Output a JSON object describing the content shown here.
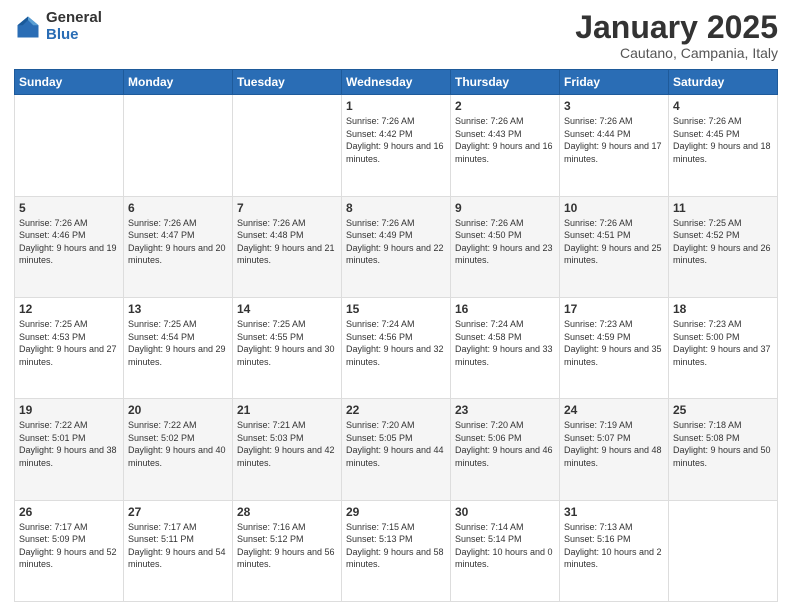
{
  "header": {
    "logo_general": "General",
    "logo_blue": "Blue",
    "title": "January 2025",
    "subtitle": "Cautano, Campania, Italy"
  },
  "weekdays": [
    "Sunday",
    "Monday",
    "Tuesday",
    "Wednesday",
    "Thursday",
    "Friday",
    "Saturday"
  ],
  "weeks": [
    [
      {
        "day": "",
        "sunrise": "",
        "sunset": "",
        "daylight": ""
      },
      {
        "day": "",
        "sunrise": "",
        "sunset": "",
        "daylight": ""
      },
      {
        "day": "",
        "sunrise": "",
        "sunset": "",
        "daylight": ""
      },
      {
        "day": "1",
        "sunrise": "Sunrise: 7:26 AM",
        "sunset": "Sunset: 4:42 PM",
        "daylight": "Daylight: 9 hours and 16 minutes."
      },
      {
        "day": "2",
        "sunrise": "Sunrise: 7:26 AM",
        "sunset": "Sunset: 4:43 PM",
        "daylight": "Daylight: 9 hours and 16 minutes."
      },
      {
        "day": "3",
        "sunrise": "Sunrise: 7:26 AM",
        "sunset": "Sunset: 4:44 PM",
        "daylight": "Daylight: 9 hours and 17 minutes."
      },
      {
        "day": "4",
        "sunrise": "Sunrise: 7:26 AM",
        "sunset": "Sunset: 4:45 PM",
        "daylight": "Daylight: 9 hours and 18 minutes."
      }
    ],
    [
      {
        "day": "5",
        "sunrise": "Sunrise: 7:26 AM",
        "sunset": "Sunset: 4:46 PM",
        "daylight": "Daylight: 9 hours and 19 minutes."
      },
      {
        "day": "6",
        "sunrise": "Sunrise: 7:26 AM",
        "sunset": "Sunset: 4:47 PM",
        "daylight": "Daylight: 9 hours and 20 minutes."
      },
      {
        "day": "7",
        "sunrise": "Sunrise: 7:26 AM",
        "sunset": "Sunset: 4:48 PM",
        "daylight": "Daylight: 9 hours and 21 minutes."
      },
      {
        "day": "8",
        "sunrise": "Sunrise: 7:26 AM",
        "sunset": "Sunset: 4:49 PM",
        "daylight": "Daylight: 9 hours and 22 minutes."
      },
      {
        "day": "9",
        "sunrise": "Sunrise: 7:26 AM",
        "sunset": "Sunset: 4:50 PM",
        "daylight": "Daylight: 9 hours and 23 minutes."
      },
      {
        "day": "10",
        "sunrise": "Sunrise: 7:26 AM",
        "sunset": "Sunset: 4:51 PM",
        "daylight": "Daylight: 9 hours and 25 minutes."
      },
      {
        "day": "11",
        "sunrise": "Sunrise: 7:25 AM",
        "sunset": "Sunset: 4:52 PM",
        "daylight": "Daylight: 9 hours and 26 minutes."
      }
    ],
    [
      {
        "day": "12",
        "sunrise": "Sunrise: 7:25 AM",
        "sunset": "Sunset: 4:53 PM",
        "daylight": "Daylight: 9 hours and 27 minutes."
      },
      {
        "day": "13",
        "sunrise": "Sunrise: 7:25 AM",
        "sunset": "Sunset: 4:54 PM",
        "daylight": "Daylight: 9 hours and 29 minutes."
      },
      {
        "day": "14",
        "sunrise": "Sunrise: 7:25 AM",
        "sunset": "Sunset: 4:55 PM",
        "daylight": "Daylight: 9 hours and 30 minutes."
      },
      {
        "day": "15",
        "sunrise": "Sunrise: 7:24 AM",
        "sunset": "Sunset: 4:56 PM",
        "daylight": "Daylight: 9 hours and 32 minutes."
      },
      {
        "day": "16",
        "sunrise": "Sunrise: 7:24 AM",
        "sunset": "Sunset: 4:58 PM",
        "daylight": "Daylight: 9 hours and 33 minutes."
      },
      {
        "day": "17",
        "sunrise": "Sunrise: 7:23 AM",
        "sunset": "Sunset: 4:59 PM",
        "daylight": "Daylight: 9 hours and 35 minutes."
      },
      {
        "day": "18",
        "sunrise": "Sunrise: 7:23 AM",
        "sunset": "Sunset: 5:00 PM",
        "daylight": "Daylight: 9 hours and 37 minutes."
      }
    ],
    [
      {
        "day": "19",
        "sunrise": "Sunrise: 7:22 AM",
        "sunset": "Sunset: 5:01 PM",
        "daylight": "Daylight: 9 hours and 38 minutes."
      },
      {
        "day": "20",
        "sunrise": "Sunrise: 7:22 AM",
        "sunset": "Sunset: 5:02 PM",
        "daylight": "Daylight: 9 hours and 40 minutes."
      },
      {
        "day": "21",
        "sunrise": "Sunrise: 7:21 AM",
        "sunset": "Sunset: 5:03 PM",
        "daylight": "Daylight: 9 hours and 42 minutes."
      },
      {
        "day": "22",
        "sunrise": "Sunrise: 7:20 AM",
        "sunset": "Sunset: 5:05 PM",
        "daylight": "Daylight: 9 hours and 44 minutes."
      },
      {
        "day": "23",
        "sunrise": "Sunrise: 7:20 AM",
        "sunset": "Sunset: 5:06 PM",
        "daylight": "Daylight: 9 hours and 46 minutes."
      },
      {
        "day": "24",
        "sunrise": "Sunrise: 7:19 AM",
        "sunset": "Sunset: 5:07 PM",
        "daylight": "Daylight: 9 hours and 48 minutes."
      },
      {
        "day": "25",
        "sunrise": "Sunrise: 7:18 AM",
        "sunset": "Sunset: 5:08 PM",
        "daylight": "Daylight: 9 hours and 50 minutes."
      }
    ],
    [
      {
        "day": "26",
        "sunrise": "Sunrise: 7:17 AM",
        "sunset": "Sunset: 5:09 PM",
        "daylight": "Daylight: 9 hours and 52 minutes."
      },
      {
        "day": "27",
        "sunrise": "Sunrise: 7:17 AM",
        "sunset": "Sunset: 5:11 PM",
        "daylight": "Daylight: 9 hours and 54 minutes."
      },
      {
        "day": "28",
        "sunrise": "Sunrise: 7:16 AM",
        "sunset": "Sunset: 5:12 PM",
        "daylight": "Daylight: 9 hours and 56 minutes."
      },
      {
        "day": "29",
        "sunrise": "Sunrise: 7:15 AM",
        "sunset": "Sunset: 5:13 PM",
        "daylight": "Daylight: 9 hours and 58 minutes."
      },
      {
        "day": "30",
        "sunrise": "Sunrise: 7:14 AM",
        "sunset": "Sunset: 5:14 PM",
        "daylight": "Daylight: 10 hours and 0 minutes."
      },
      {
        "day": "31",
        "sunrise": "Sunrise: 7:13 AM",
        "sunset": "Sunset: 5:16 PM",
        "daylight": "Daylight: 10 hours and 2 minutes."
      },
      {
        "day": "",
        "sunrise": "",
        "sunset": "",
        "daylight": ""
      }
    ]
  ]
}
